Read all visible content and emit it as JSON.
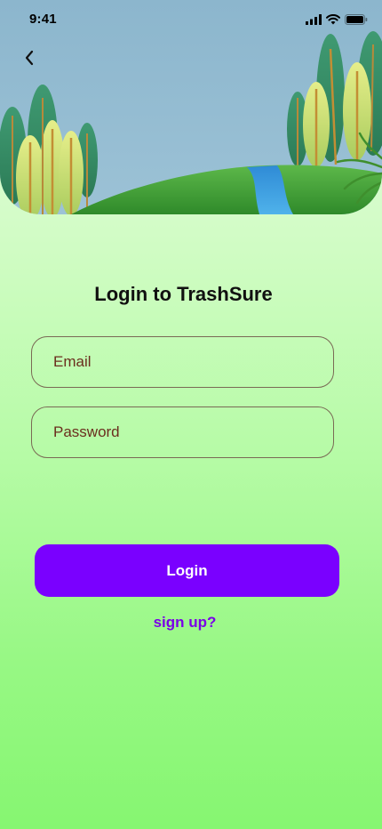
{
  "status_bar": {
    "time": "9:41"
  },
  "header": {
    "back_icon": "chevron-left-icon"
  },
  "main": {
    "title": "Login to TrashSure",
    "email_placeholder": "Email",
    "password_placeholder": "Password",
    "login_label": "Login",
    "signup_label": "sign up?"
  },
  "colors": {
    "accent": "#7a00ff",
    "signup_text": "#7a00e8",
    "background_top": "#eafde4",
    "background_bottom": "#86f671",
    "sky": "#8fb8cf",
    "hill": "#3e9a34",
    "river": "#3d9be0"
  }
}
